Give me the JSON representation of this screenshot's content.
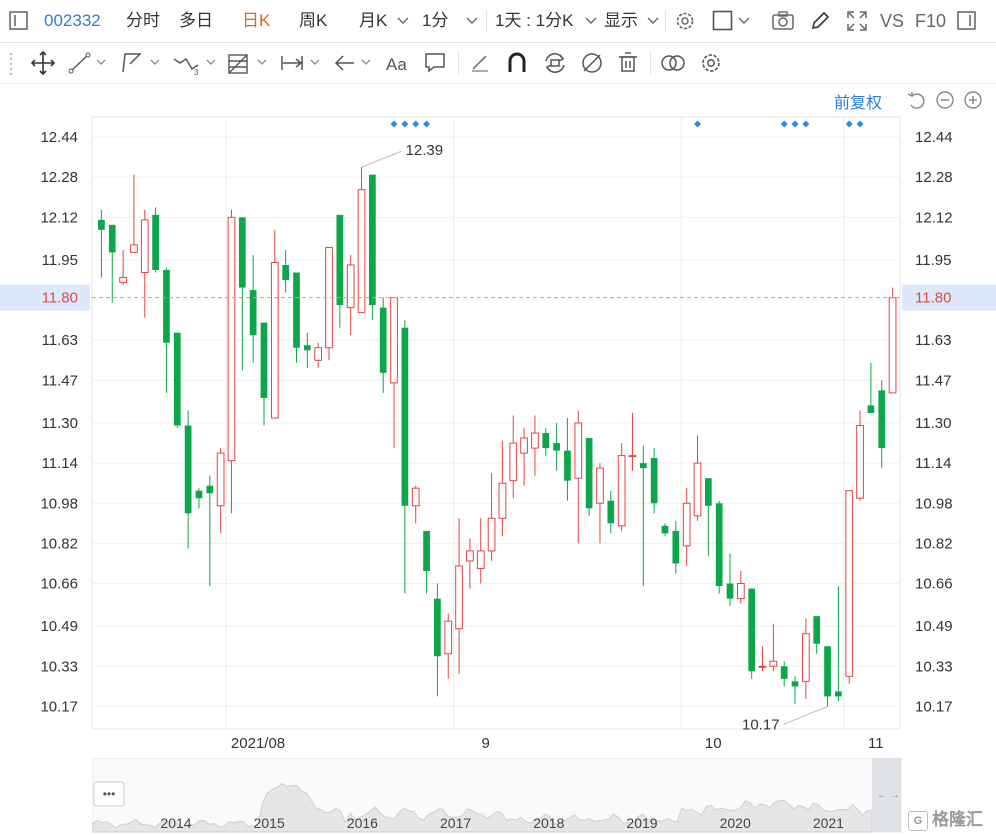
{
  "header": {
    "stock_code": "002332",
    "periods": [
      "分时",
      "多日",
      "日K",
      "周K",
      "月K"
    ],
    "active_period": "日K",
    "interval": "1分",
    "multi_period": "1天 : 1分K",
    "display": "显示",
    "vs": "VS",
    "f10": "F10",
    "colors": {
      "code": "#2b7de1",
      "active": "#e8641b",
      "text": "#333333"
    }
  },
  "chart_header": {
    "adjust_label": "前复权"
  },
  "chart_data": {
    "type": "candlestick",
    "y_ticks": [
      "12.44",
      "12.28",
      "12.12",
      "11.95",
      "11.80",
      "11.63",
      "11.47",
      "11.30",
      "11.14",
      "10.98",
      "10.82",
      "10.66",
      "10.49",
      "10.33",
      "10.17"
    ],
    "ylim": [
      10.08,
      12.52
    ],
    "x_ticks": [
      "2021/08",
      "9",
      "10",
      "11"
    ],
    "current_price": "11.80",
    "high_annotation": "12.39",
    "low_annotation": "10.17",
    "candles": [
      {
        "o": 12.11,
        "h": 12.15,
        "l": 11.88,
        "c": 12.07
      },
      {
        "o": 12.09,
        "h": 12.09,
        "l": 11.78,
        "c": 11.98
      },
      {
        "o": 11.86,
        "h": 11.99,
        "l": 11.85,
        "c": 11.88
      },
      {
        "o": 11.98,
        "h": 12.29,
        "l": 11.98,
        "c": 12.01
      },
      {
        "o": 11.9,
        "h": 12.15,
        "l": 11.72,
        "c": 12.11
      },
      {
        "o": 12.13,
        "h": 12.16,
        "l": 11.9,
        "c": 11.91
      },
      {
        "o": 11.91,
        "h": 11.92,
        "l": 11.42,
        "c": 11.62
      },
      {
        "o": 11.66,
        "h": 11.66,
        "l": 11.28,
        "c": 11.29
      },
      {
        "o": 11.29,
        "h": 11.35,
        "l": 10.8,
        "c": 10.94
      },
      {
        "o": 11.03,
        "h": 11.04,
        "l": 10.96,
        "c": 11.0
      },
      {
        "o": 11.05,
        "h": 11.09,
        "l": 10.65,
        "c": 11.02
      },
      {
        "o": 10.97,
        "h": 11.2,
        "l": 10.86,
        "c": 11.18
      },
      {
        "o": 11.15,
        "h": 12.15,
        "l": 10.94,
        "c": 12.12
      },
      {
        "o": 12.12,
        "h": 12.12,
        "l": 11.51,
        "c": 11.84
      },
      {
        "o": 11.83,
        "h": 11.97,
        "l": 11.54,
        "c": 11.65
      },
      {
        "o": 11.7,
        "h": 11.7,
        "l": 11.29,
        "c": 11.4
      },
      {
        "o": 11.32,
        "h": 12.07,
        "l": 11.32,
        "c": 11.94
      },
      {
        "o": 11.93,
        "h": 11.99,
        "l": 11.82,
        "c": 11.87
      },
      {
        "o": 11.9,
        "h": 11.9,
        "l": 11.54,
        "c": 11.6
      },
      {
        "o": 11.61,
        "h": 11.66,
        "l": 11.52,
        "c": 11.59
      },
      {
        "o": 11.55,
        "h": 11.62,
        "l": 11.52,
        "c": 11.6
      },
      {
        "o": 11.6,
        "h": 12.0,
        "l": 11.55,
        "c": 12.0
      },
      {
        "o": 12.13,
        "h": 12.13,
        "l": 11.68,
        "c": 11.77
      },
      {
        "o": 11.76,
        "h": 11.97,
        "l": 11.65,
        "c": 11.93
      },
      {
        "o": 11.74,
        "h": 12.32,
        "l": 11.74,
        "c": 12.23
      },
      {
        "o": 12.29,
        "h": 12.29,
        "l": 11.71,
        "c": 11.77
      },
      {
        "o": 11.76,
        "h": 11.8,
        "l": 11.42,
        "c": 11.5
      },
      {
        "o": 11.46,
        "h": 11.8,
        "l": 11.2,
        "c": 11.8
      },
      {
        "o": 11.68,
        "h": 11.71,
        "l": 10.62,
        "c": 10.97
      },
      {
        "o": 10.97,
        "h": 11.05,
        "l": 10.9,
        "c": 11.04
      },
      {
        "o": 10.87,
        "h": 10.87,
        "l": 10.62,
        "c": 10.71
      },
      {
        "o": 10.6,
        "h": 10.66,
        "l": 10.21,
        "c": 10.37
      },
      {
        "o": 10.38,
        "h": 10.54,
        "l": 10.28,
        "c": 10.51
      },
      {
        "o": 10.48,
        "h": 10.92,
        "l": 10.3,
        "c": 10.73
      },
      {
        "o": 10.75,
        "h": 10.84,
        "l": 10.64,
        "c": 10.79
      },
      {
        "o": 10.72,
        "h": 10.92,
        "l": 10.66,
        "c": 10.79
      },
      {
        "o": 10.79,
        "h": 11.1,
        "l": 10.75,
        "c": 10.92
      },
      {
        "o": 10.92,
        "h": 11.23,
        "l": 10.85,
        "c": 11.06
      },
      {
        "o": 11.07,
        "h": 11.33,
        "l": 11.0,
        "c": 11.22
      },
      {
        "o": 11.18,
        "h": 11.28,
        "l": 11.05,
        "c": 11.24
      },
      {
        "o": 11.2,
        "h": 11.33,
        "l": 11.09,
        "c": 11.26
      },
      {
        "o": 11.26,
        "h": 11.28,
        "l": 11.17,
        "c": 11.2
      },
      {
        "o": 11.22,
        "h": 11.3,
        "l": 11.11,
        "c": 11.19
      },
      {
        "o": 11.19,
        "h": 11.32,
        "l": 10.99,
        "c": 11.07
      },
      {
        "o": 11.08,
        "h": 11.35,
        "l": 10.82,
        "c": 11.3
      },
      {
        "o": 11.24,
        "h": 11.24,
        "l": 10.93,
        "c": 10.96
      },
      {
        "o": 10.98,
        "h": 11.14,
        "l": 10.82,
        "c": 11.12
      },
      {
        "o": 10.99,
        "h": 11.03,
        "l": 10.86,
        "c": 10.9
      },
      {
        "o": 10.89,
        "h": 11.22,
        "l": 10.87,
        "c": 11.17
      },
      {
        "o": 11.17,
        "h": 11.34,
        "l": 11.11,
        "c": 11.17
      },
      {
        "o": 11.14,
        "h": 11.21,
        "l": 10.65,
        "c": 11.12
      },
      {
        "o": 11.16,
        "h": 11.2,
        "l": 10.94,
        "c": 10.98
      },
      {
        "o": 10.89,
        "h": 10.9,
        "l": 10.85,
        "c": 10.86
      },
      {
        "o": 10.87,
        "h": 10.91,
        "l": 10.7,
        "c": 10.74
      },
      {
        "o": 10.81,
        "h": 11.04,
        "l": 10.73,
        "c": 10.98
      },
      {
        "o": 10.93,
        "h": 11.25,
        "l": 10.91,
        "c": 11.14
      },
      {
        "o": 11.08,
        "h": 11.08,
        "l": 10.77,
        "c": 10.97
      },
      {
        "o": 10.98,
        "h": 10.99,
        "l": 10.62,
        "c": 10.65
      },
      {
        "o": 10.66,
        "h": 10.78,
        "l": 10.57,
        "c": 10.6
      },
      {
        "o": 10.6,
        "h": 10.71,
        "l": 10.58,
        "c": 10.66
      },
      {
        "o": 10.64,
        "h": 10.64,
        "l": 10.28,
        "c": 10.31
      },
      {
        "o": 10.33,
        "h": 10.41,
        "l": 10.31,
        "c": 10.33
      },
      {
        "o": 10.33,
        "h": 10.5,
        "l": 10.31,
        "c": 10.35
      },
      {
        "o": 10.33,
        "h": 10.35,
        "l": 10.25,
        "c": 10.28
      },
      {
        "o": 10.27,
        "h": 10.29,
        "l": 10.18,
        "c": 10.25
      },
      {
        "o": 10.27,
        "h": 10.52,
        "l": 10.2,
        "c": 10.46
      },
      {
        "o": 10.53,
        "h": 10.53,
        "l": 10.38,
        "c": 10.42
      },
      {
        "o": 10.41,
        "h": 10.41,
        "l": 10.17,
        "c": 10.21
      },
      {
        "o": 10.23,
        "h": 10.65,
        "l": 10.19,
        "c": 10.21
      },
      {
        "o": 10.29,
        "h": 11.03,
        "l": 10.26,
        "c": 11.03
      },
      {
        "o": 11.0,
        "h": 11.35,
        "l": 10.99,
        "c": 11.29
      },
      {
        "o": 11.37,
        "h": 11.54,
        "l": 11.34,
        "c": 11.34
      },
      {
        "o": 11.43,
        "h": 11.47,
        "l": 11.12,
        "c": 11.2
      },
      {
        "o": 11.42,
        "h": 11.84,
        "l": 11.42,
        "c": 11.8
      }
    ]
  },
  "overview": {
    "years": [
      "2014",
      "2015",
      "2016",
      "2017",
      "2018",
      "2019",
      "2020",
      "2021"
    ],
    "more": "•••",
    "watermark": "格隆汇"
  }
}
